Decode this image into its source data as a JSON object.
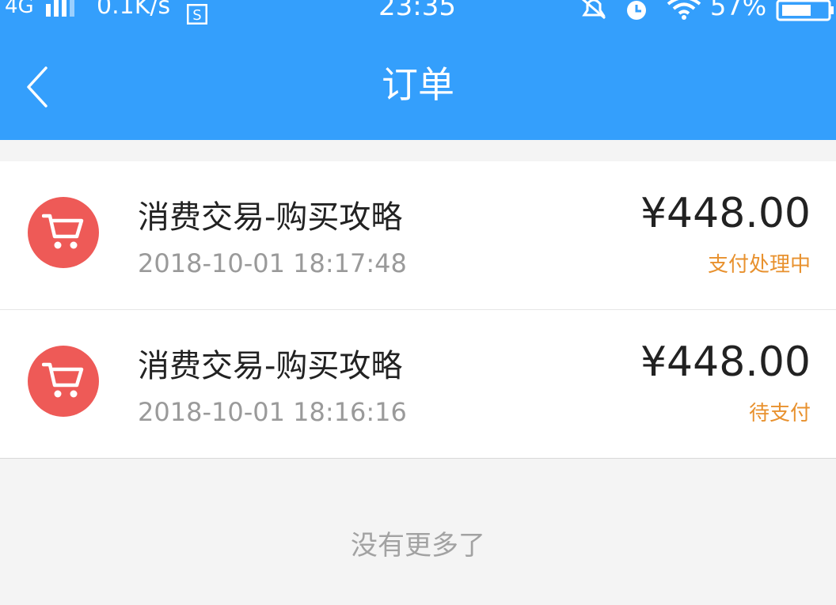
{
  "status_bar": {
    "network": "4G",
    "speed": "0.1K/s",
    "time": "23:35",
    "battery": "57%"
  },
  "header": {
    "title": "订单",
    "back_icon": "chevron-left-icon"
  },
  "orders": [
    {
      "icon": "shopping-cart-icon",
      "title": "消费交易-购买攻略",
      "time": "2018-10-01 18:17:48",
      "amount": "¥448.00",
      "status": "支付处理中"
    },
    {
      "icon": "shopping-cart-icon",
      "title": "消费交易-购买攻略",
      "time": "2018-10-01 18:16:16",
      "amount": "¥448.00",
      "status": "待支付"
    }
  ],
  "footer": {
    "no_more": "没有更多了"
  },
  "colors": {
    "header_bg": "#349ffc",
    "cart_badge": "#ee5a57",
    "status_text": "#e8912e"
  }
}
